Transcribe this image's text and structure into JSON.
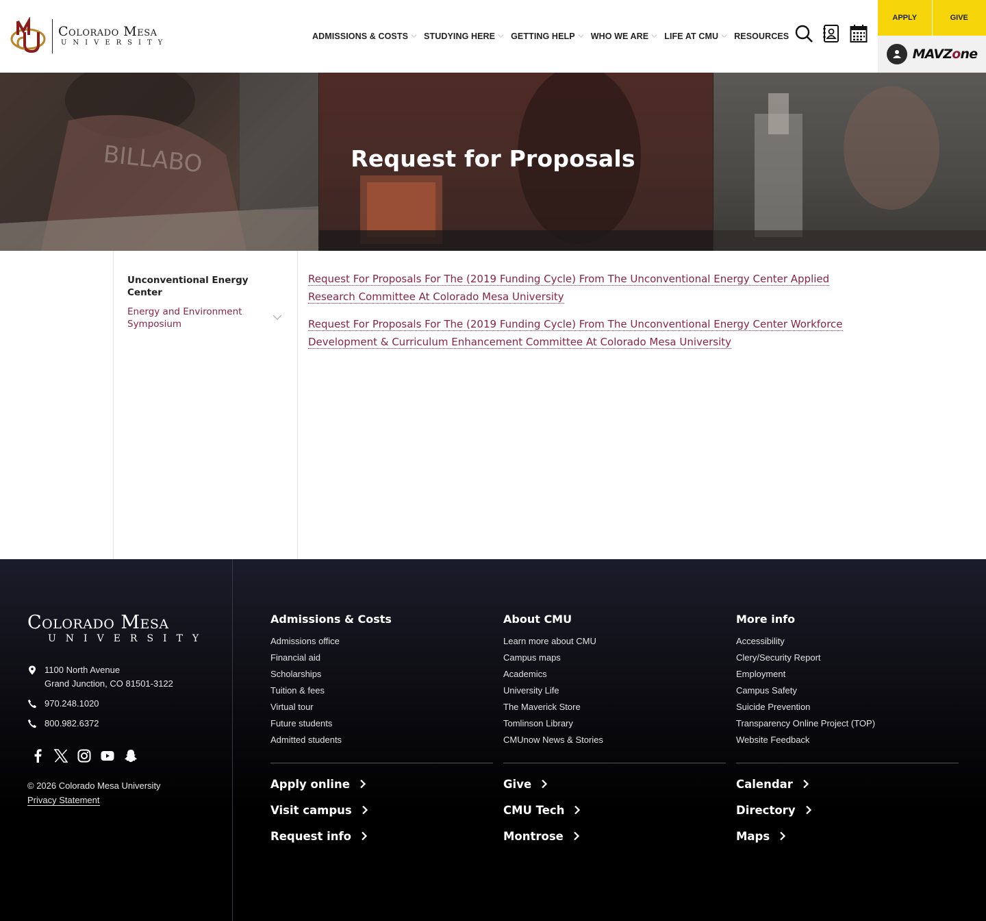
{
  "header": {
    "logo": {
      "name": "Colorado Mesa",
      "university": "UNIVERSITY"
    },
    "nav": [
      {
        "label": "ADMISSIONS & COSTS",
        "dropdown": true
      },
      {
        "label": "STUDYING HERE",
        "dropdown": true
      },
      {
        "label": "GETTING HELP",
        "dropdown": true
      },
      {
        "label": "WHO WE ARE",
        "dropdown": true
      },
      {
        "label": "LIFE AT CMU",
        "dropdown": true
      },
      {
        "label": "RESOURCES",
        "dropdown": false
      }
    ],
    "icons": [
      "search-icon",
      "directory-icon",
      "calendar-icon"
    ],
    "apply_label": "APPLY",
    "give_label": "GIVE",
    "mavzone": {
      "prefix": "MAVZ",
      "o": "o",
      "suffix": "ne"
    }
  },
  "hero": {
    "title": "Request for Proposals"
  },
  "sidebar": {
    "title": "Unconventional Energy Center",
    "link": "Energy and Environment Symposium"
  },
  "content": {
    "links": [
      " Request For Proposals For The (2019 Funding Cycle) From The Unconventional Energy Center Applied Research Committee At Colorado Mesa University ",
      " Request For Proposals For The (2019 Funding Cycle) From The Unconventional Energy Center Workforce Development & Curriculum Enhancement Committee At Colorado Mesa University "
    ]
  },
  "footer": {
    "logo": {
      "name": "Colorado Mesa",
      "university": "UNIVERSITY"
    },
    "address_line1": "1100 North Avenue",
    "address_line2": "Grand Junction, CO 81501-3122",
    "phone1": "970.248.1020",
    "phone2": "800.982.6372",
    "social": [
      "facebook-icon",
      "x-icon",
      "instagram-icon",
      "youtube-icon",
      "snapchat-icon"
    ],
    "copyright": "© 2026 Colorado Mesa University",
    "privacy": "Privacy Statement",
    "columns": [
      {
        "title": "Admissions & Costs",
        "items": [
          "Admissions office",
          "Financial aid",
          "Scholarships",
          "Tuition & fees",
          "Virtual tour",
          "Future students",
          "Admitted students"
        ],
        "big_links": [
          "Apply online",
          "Visit campus",
          "Request info"
        ]
      },
      {
        "title": "About CMU",
        "items": [
          "Learn more about CMU",
          "Campus maps",
          "Academics",
          "University Life",
          "The Maverick Store",
          "Tomlinson Library",
          "CMUnow News & Stories"
        ],
        "big_links": [
          "Give",
          "CMU Tech",
          "Montrose"
        ]
      },
      {
        "title": "More info",
        "items": [
          "Accessibility",
          "Clery/Security Report",
          "Employment",
          "Campus Safety",
          "Suicide Prevention",
          "Transparency Online Project (TOP)",
          "Website Feedback"
        ],
        "big_links": [
          "Calendar",
          "Directory",
          "Maps"
        ]
      }
    ]
  }
}
